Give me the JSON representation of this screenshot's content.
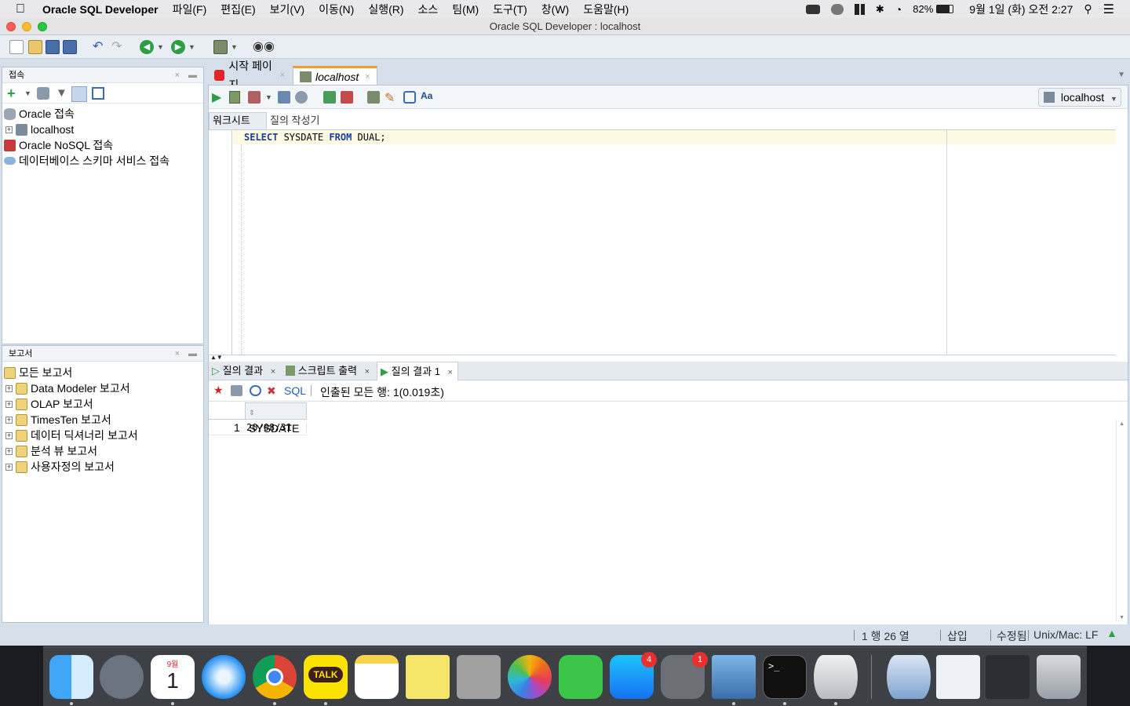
{
  "menubar": {
    "app_name": "Oracle SQL Developer",
    "menus": [
      "파일(F)",
      "편집(E)",
      "보기(V)",
      "이동(N)",
      "실행(R)",
      "소스",
      "팀(M)",
      "도구(T)",
      "창(W)",
      "도움말(H)"
    ],
    "battery": "82%",
    "datetime": "9월 1일 (화) 오전 2:27"
  },
  "window": {
    "title": "Oracle SQL Developer : localhost"
  },
  "connections": {
    "header": "접속",
    "items": [
      "Oracle 접속",
      "localhost",
      "Oracle NoSQL 접속",
      "데이터베이스 스키마 서비스 접속"
    ]
  },
  "reports": {
    "header": "보고서",
    "items": [
      "모든 보고서",
      "Data Modeler 보고서",
      "OLAP 보고서",
      "TimesTen 보고서",
      "데이터 딕셔너리 보고서",
      "분석 뷰 보고서",
      "사용자정의 보고서"
    ]
  },
  "doc_tabs": [
    "시작 페이지",
    "localhost"
  ],
  "connection_selector": "localhost",
  "editor_tabs": [
    "워크시트",
    "질의 작성기"
  ],
  "sql": {
    "kw1": "SELECT",
    "mid": " SYSDATE ",
    "kw2": "FROM",
    "tail": " DUAL;"
  },
  "result_tabs": [
    "질의 결과",
    "스크립트 출력",
    "질의 결과 1"
  ],
  "result": {
    "sql_link": "SQL",
    "fetch_info": "인출된 모든 행: 1(0.019초)",
    "column": "SYSDATE",
    "rows": [
      {
        "num": "1",
        "value": "20/08/31"
      }
    ]
  },
  "status": {
    "position": "1 행 26 열",
    "mode": "삽입",
    "modified": "수정됨",
    "line_ending": "Unix/Mac: LF"
  },
  "dock": {
    "calendar_month": "9월",
    "calendar_day": "1",
    "appstore_badge": "4",
    "settings_badge": "1",
    "talk_label": "TALK"
  }
}
